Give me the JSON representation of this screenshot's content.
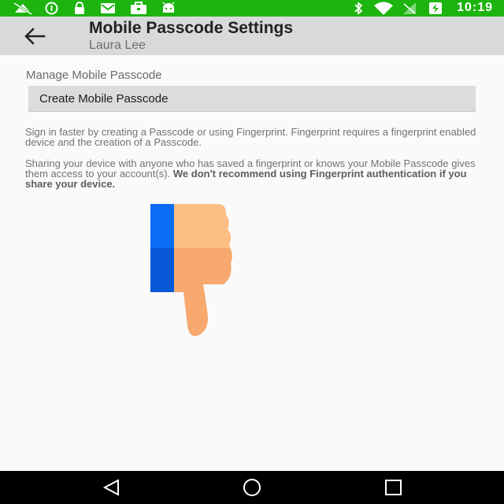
{
  "status_bar": {
    "time": "10:19",
    "icons": [
      "signal-off-icon",
      "info-circle-icon",
      "lock-icon",
      "mail-icon",
      "briefcase-icon",
      "android-icon",
      "bluetooth-icon",
      "wifi-icon",
      "no-signal-icon",
      "battery-charging-icon"
    ],
    "color": "#1db410"
  },
  "app_bar": {
    "title": "Mobile Passcode Settings",
    "subtitle": "Laura Lee",
    "back_icon": "arrow-back-icon"
  },
  "main": {
    "section_label": "Manage Mobile Passcode",
    "create_button_label": "Create Mobile Passcode",
    "info_paragraph": "Sign in faster by creating a Passcode or using Fingerprint. Fingerprint requires a fingerprint enabled device and the creation of a Passcode.",
    "warning_paragraph": "Sharing your device with anyone who has saved a fingerprint or knows your Mobile Passcode gives them access to your account(s).",
    "warning_bold": "We don't recommend using Fingerprint authentication if you share your device.",
    "thumb_icon": "thumbs-down-icon"
  },
  "nav_bar": {
    "back": "nav-back-icon",
    "home": "nav-home-icon",
    "recents": "nav-recents-icon"
  }
}
